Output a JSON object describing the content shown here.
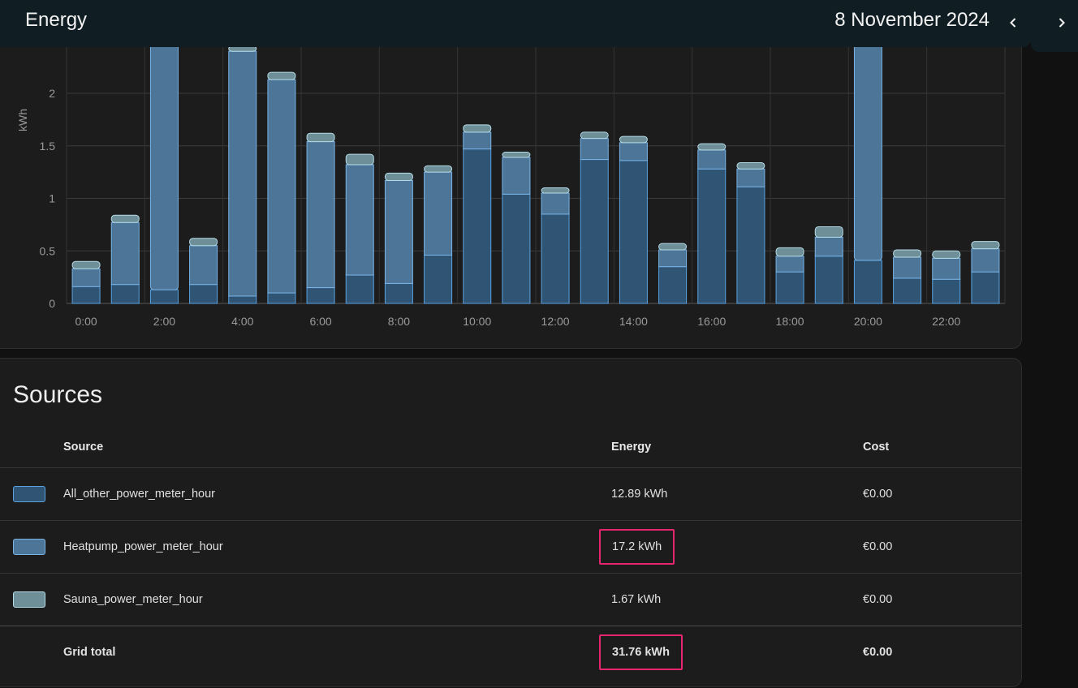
{
  "header": {
    "title": "Energy",
    "date": "8 November 2024"
  },
  "chart_data": {
    "type": "bar",
    "stacked": true,
    "ylabel": "kWh",
    "ylim": [
      0,
      2.45
    ],
    "yticks": [
      "0",
      "0.5",
      "1",
      "1.5",
      "2"
    ],
    "ytick_values": [
      0,
      0.5,
      1,
      1.5,
      2
    ],
    "xticks": [
      "0:00",
      "2:00",
      "4:00",
      "6:00",
      "8:00",
      "10:00",
      "12:00",
      "14:00",
      "16:00",
      "18:00",
      "20:00",
      "22:00"
    ],
    "categories": [
      "0:00",
      "1:00",
      "2:00",
      "3:00",
      "4:00",
      "5:00",
      "6:00",
      "7:00",
      "8:00",
      "9:00",
      "10:00",
      "11:00",
      "12:00",
      "13:00",
      "14:00",
      "15:00",
      "16:00",
      "17:00",
      "18:00",
      "19:00",
      "20:00",
      "21:00",
      "22:00",
      "23:00"
    ],
    "series": [
      {
        "name": "All_other_power_meter_hour",
        "color": "#2f5474",
        "stroke": "#5aa2e0",
        "values": [
          0.16,
          0.18,
          0.13,
          0.18,
          0.07,
          0.1,
          0.15,
          0.27,
          0.19,
          0.46,
          1.47,
          1.04,
          0.85,
          1.37,
          1.36,
          0.35,
          1.28,
          1.11,
          0.3,
          0.45,
          0.41,
          0.24,
          0.23,
          0.3
        ]
      },
      {
        "name": "Heatpump_power_meter_hour",
        "color": "#4d7597",
        "stroke": "#7ab4e6",
        "values": [
          0.17,
          0.59,
          2.8,
          0.37,
          2.33,
          2.03,
          1.39,
          1.05,
          0.98,
          0.79,
          0.16,
          0.35,
          0.2,
          0.2,
          0.17,
          0.16,
          0.18,
          0.17,
          0.15,
          0.18,
          2.6,
          0.2,
          0.2,
          0.22
        ]
      },
      {
        "name": "Sauna_power_meter_hour",
        "color": "#6e8f98",
        "stroke": "#b5dbe6",
        "values": [
          0.07,
          0.07,
          0.0,
          0.07,
          0.05,
          0.07,
          0.08,
          0.1,
          0.07,
          0.06,
          0.07,
          0.05,
          0.05,
          0.06,
          0.06,
          0.06,
          0.06,
          0.06,
          0.08,
          0.1,
          0.0,
          0.07,
          0.07,
          0.07
        ]
      }
    ]
  },
  "sources": {
    "title": "Sources",
    "columns": {
      "source": "Source",
      "energy": "Energy",
      "cost": "Cost"
    },
    "rows": [
      {
        "name": "All_other_power_meter_hour",
        "energy": "12.89 kWh",
        "cost": "€0.00",
        "color": "#2f5474",
        "border": "#5aa2e0"
      },
      {
        "name": "Heatpump_power_meter_hour",
        "energy": "17.2 kWh",
        "cost": "€0.00",
        "color": "#4d7597",
        "border": "#7ab4e6"
      },
      {
        "name": "Sauna_power_meter_hour",
        "energy": "1.67 kWh",
        "cost": "€0.00",
        "color": "#6e8f98",
        "border": "#b5dbe6"
      }
    ],
    "total": {
      "label": "Grid total",
      "energy": "31.76 kWh",
      "cost": "€0.00"
    }
  },
  "icons": {
    "prev": "chevron-left-icon",
    "next": "chevron-right-icon"
  },
  "highlight_color": "#e5256e"
}
